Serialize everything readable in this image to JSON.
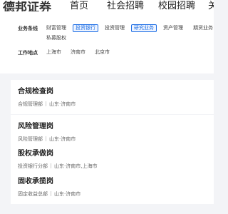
{
  "header": {
    "logo_text": "德邦证券",
    "nav": [
      "首页",
      "社会招聘",
      "校园招聘",
      "关"
    ]
  },
  "filters": {
    "business_line": {
      "label": "业务条线",
      "options": [
        {
          "text": "财富管理",
          "selected": false
        },
        {
          "text": "投资银行",
          "selected": true
        },
        {
          "text": "投资管理",
          "selected": false
        },
        {
          "text": "研究业务",
          "selected": true
        },
        {
          "text": "资产管理",
          "selected": false
        },
        {
          "text": "期货业务",
          "selected": false
        },
        {
          "text": "私募股权",
          "selected": false
        }
      ]
    },
    "location": {
      "label": "工作地点",
      "options": [
        "上海市",
        "济南市",
        "北京市"
      ]
    }
  },
  "jobs": [
    {
      "title": "合规检查岗",
      "department": "合规管理部",
      "location": "山东·济南市"
    },
    {
      "title": "风险管理岗",
      "department": "风险管理部",
      "location": "山东·济南市"
    },
    {
      "title": "股权承做岗",
      "department": "投资银行分部",
      "location": "山东·济南市,上海市"
    },
    {
      "title": "固收承揽岗",
      "department": "固定收益总部",
      "location": "山东·济南市"
    }
  ],
  "colors": {
    "accent": "#1e6fe5",
    "background": "#f3f4f7"
  }
}
